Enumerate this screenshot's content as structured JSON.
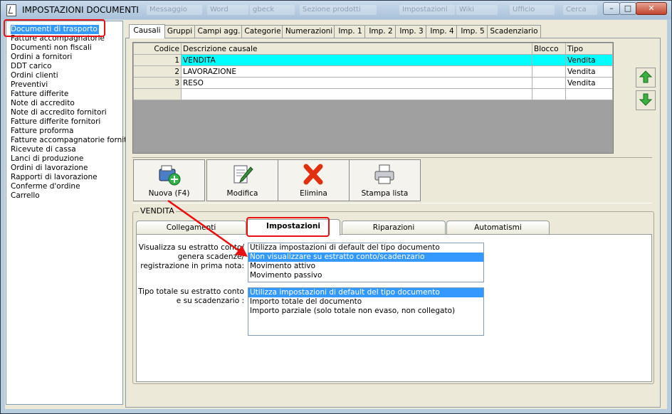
{
  "window": {
    "title": "IMPOSTAZIONI DOCUMENTI",
    "controls": {
      "minimize": "–",
      "maximize": "□",
      "close": "✕"
    }
  },
  "sidebar": {
    "items": [
      "Documenti di trasporto",
      "Fatture accompagnatorie",
      "Documenti non fiscali",
      "Ordini a fornitori",
      "DDT carico",
      "Ordini clienti",
      "Preventivi",
      "Fatture differite",
      "Note di accredito",
      "Note di accredito fornitori",
      "Fatture differite fornitori",
      "Fatture proforma",
      "Fatture accompagnatorie fornitori",
      "Ricevute di cassa",
      "Lanci di produzione",
      "Ordini di lavorazione",
      "Rapporti di lavorazione",
      "Conferme d'ordine",
      "Carrello"
    ]
  },
  "tabs": [
    "Causali",
    "Gruppi",
    "Campi agg.",
    "Categorie",
    "Numerazioni",
    "Imp. 1",
    "Imp. 2",
    "Imp. 3",
    "Imp. 4",
    "Imp. 5",
    "Scadenziario"
  ],
  "grid": {
    "columns": [
      "Codice",
      "Descrizione causale",
      "Blocco",
      "Tipo"
    ],
    "rows": [
      {
        "codice": "1",
        "descrizione": "VENDITA",
        "blocco": "",
        "tipo": "Vendita"
      },
      {
        "codice": "2",
        "descrizione": "LAVORAZIONE",
        "blocco": "",
        "tipo": "Vendita"
      },
      {
        "codice": "3",
        "descrizione": "RESO",
        "blocco": "",
        "tipo": "Vendita"
      }
    ]
  },
  "toolbar": {
    "new_label": "Nuova (F4)",
    "edit_label": "Modifica",
    "delete_label": "Elimina",
    "print_label": "Stampa lista"
  },
  "group": {
    "title": "VENDITA",
    "tabs": [
      "Collegamenti",
      "Impostazioni",
      "Riparazioni",
      "Automatismi"
    ],
    "field1": {
      "label_lines": [
        "Visualizza su estratto conto/",
        "genera scadenze/",
        "registrazione  in prima nota:"
      ],
      "options": [
        "Utilizza impostazioni di default del tipo documento",
        "Non visualizzare su estratto conto/scadenzario",
        "Movimento attivo",
        "Movimento passivo"
      ]
    },
    "field2": {
      "label_lines": [
        "Tipo totale su estratto conto",
        "e su scadenzario :"
      ],
      "options": [
        "Utilizza impostazioni di default del tipo documento",
        "Importo totale del documento",
        "Importo parziale (solo totale non evaso, non collegato)"
      ]
    }
  },
  "colors": {
    "highlight_row": "#00ffff",
    "selection": "#3399ff",
    "annotation_red": "#e81010"
  },
  "taskbar_ghost": [
    "Messaggio",
    "Word",
    "gbeck",
    "Sezione prodotti",
    "Impostazioni",
    "Wiki",
    "Ufficio",
    "Cerca"
  ]
}
